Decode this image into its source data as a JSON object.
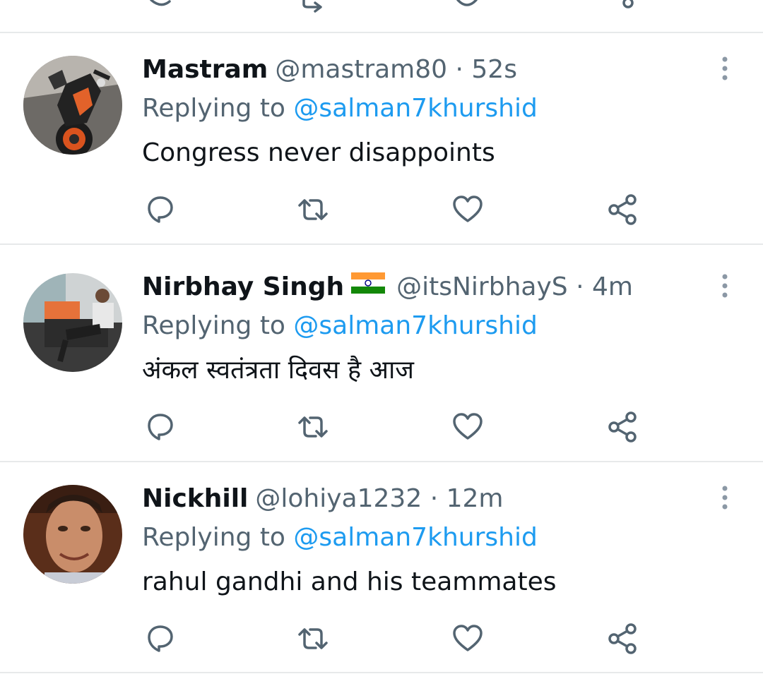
{
  "reply_prefix": "Replying to",
  "more_icon": "more-vertical-icon",
  "actions": [
    "reply-icon",
    "retweet-icon",
    "like-icon",
    "share-icon"
  ],
  "colors": {
    "mention": "#1d9bf0",
    "secondary_text": "#536471",
    "divider": "#e7e9ea"
  },
  "tweets": [
    {
      "display_name": "Mastram",
      "flag": "",
      "handle": "@mastram80",
      "time": "· 52s",
      "reply_to": "@salman7khurshid",
      "text": "Congress never disappoints"
    },
    {
      "display_name": "Nirbhay Singh",
      "flag": "🇮🇳",
      "handle": "@itsNirbhayS",
      "time": "· 4m",
      "reply_to": "@salman7khurshid",
      "text": "अंकल स्वतंत्रता दिवस है आज"
    },
    {
      "display_name": "Nickhill",
      "flag": "",
      "handle": "@lohiya1232",
      "time": "· 12m",
      "reply_to": "@salman7khurshid",
      "text": "rahul gandhi and his teammates"
    }
  ]
}
